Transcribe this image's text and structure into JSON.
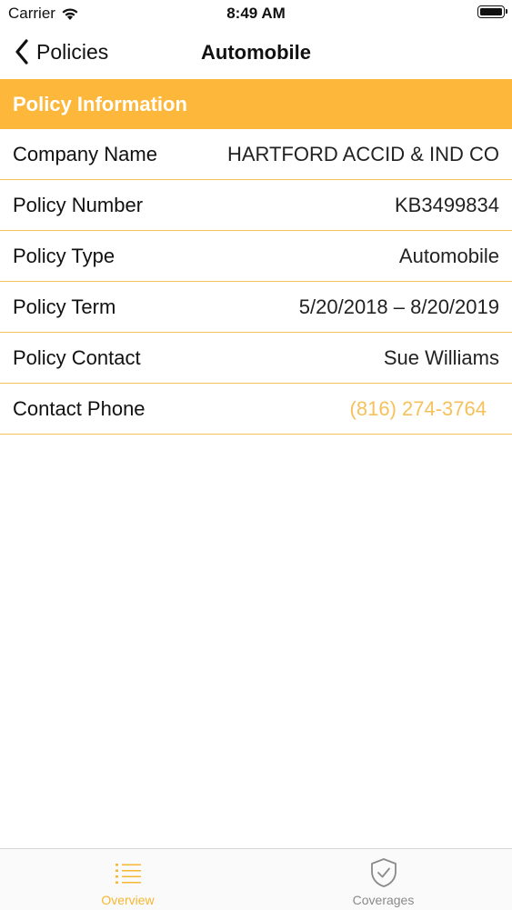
{
  "status_bar": {
    "carrier": "Carrier",
    "time": "8:49 AM"
  },
  "nav": {
    "back_label": "Policies",
    "title": "Automobile"
  },
  "section": {
    "title": "Policy Information"
  },
  "rows": [
    {
      "label": "Company Name",
      "value": "HARTFORD ACCID & IND CO"
    },
    {
      "label": "Policy Number",
      "value": "KB3499834"
    },
    {
      "label": "Policy Type",
      "value": "Automobile"
    },
    {
      "label": "Policy Term",
      "value": "5/20/2018 – 8/20/2019"
    },
    {
      "label": "Policy Contact",
      "value": "Sue Williams"
    },
    {
      "label": "Contact Phone",
      "value": "(816) 274-3764"
    }
  ],
  "tabs": [
    {
      "label": "Overview",
      "icon": "list-icon",
      "active": true
    },
    {
      "label": "Coverages",
      "icon": "shield-check-icon",
      "active": false
    }
  ],
  "colors": {
    "accent": "#fdb83c",
    "link": "#f6c15a",
    "divider": "#f6c15a"
  }
}
